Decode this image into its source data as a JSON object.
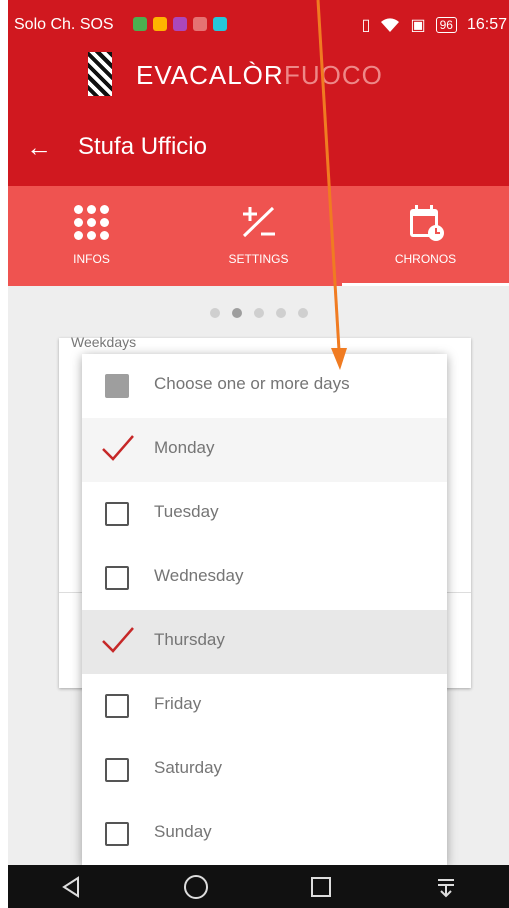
{
  "status_bar": {
    "carrier": "Solo Ch. SOS",
    "battery": "96",
    "time": "16:57"
  },
  "brand": {
    "text1": "EVACALÒR",
    "text2": "FUOCO"
  },
  "app_bar": {
    "title": "Stufa Ufficio"
  },
  "tabs": [
    {
      "label": "INFOS",
      "icon": "grid-dots-icon"
    },
    {
      "label": "SETTINGS",
      "icon": "plus-minus-icon"
    },
    {
      "label": "CHRONOS",
      "icon": "calendar-clock-icon",
      "active": true
    }
  ],
  "pager": {
    "count": 5,
    "active_index": 1
  },
  "background_card": {
    "label": "Weekdays"
  },
  "dialog": {
    "title": "Choose one or more days",
    "days": [
      {
        "label": "Monday",
        "checked": true
      },
      {
        "label": "Tuesday",
        "checked": false
      },
      {
        "label": "Wednesday",
        "checked": false
      },
      {
        "label": "Thursday",
        "checked": true
      },
      {
        "label": "Friday",
        "checked": false
      },
      {
        "label": "Saturday",
        "checked": false
      },
      {
        "label": "Sunday",
        "checked": false
      }
    ]
  },
  "nav_bar": [
    "back-icon",
    "home-icon",
    "recents-icon",
    "notifications-pull-icon"
  ],
  "colors": {
    "primary": "#d0181f",
    "tab_bar": "#ef5350",
    "checkmark": "#c62828",
    "annotation_arrow": "#f07b21"
  }
}
